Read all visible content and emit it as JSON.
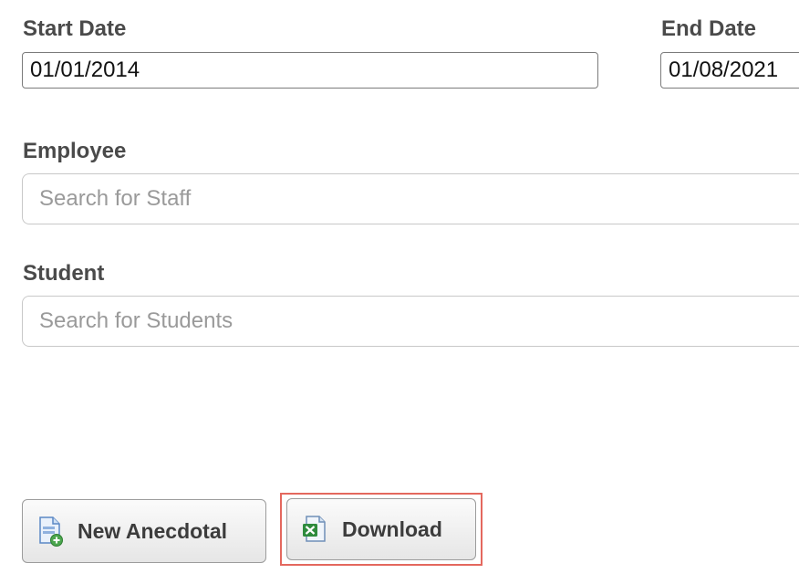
{
  "start_date": {
    "label": "Start Date",
    "value": "01/01/2014"
  },
  "end_date": {
    "label": "End Date",
    "value": "01/08/2021"
  },
  "employee": {
    "label": "Employee",
    "placeholder": "Search for Staff"
  },
  "student": {
    "label": "Student",
    "placeholder": "Search for Students"
  },
  "buttons": {
    "new_anecdotal": {
      "label": "New Anecdotal",
      "icon": "document-add-icon"
    },
    "download": {
      "label": "Download",
      "icon": "excel-spreadsheet-icon",
      "highlighted": true,
      "highlight_color": "#e4685e"
    }
  }
}
